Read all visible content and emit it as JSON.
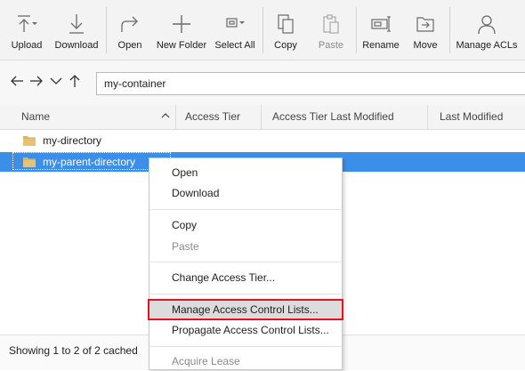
{
  "toolbar": {
    "buttons": [
      {
        "label": "Upload",
        "icon": "upload-icon"
      },
      {
        "label": "Download",
        "icon": "download-icon"
      },
      {
        "label": "Open",
        "icon": "open-arrow-icon"
      },
      {
        "label": "New Folder",
        "icon": "plus-icon"
      },
      {
        "label": "Select All",
        "icon": "select-all-icon"
      },
      {
        "label": "Copy",
        "icon": "copy-icon"
      },
      {
        "label": "Paste",
        "icon": "paste-icon",
        "disabled": true
      },
      {
        "label": "Rename",
        "icon": "rename-icon"
      },
      {
        "label": "Move",
        "icon": "move-icon"
      },
      {
        "label": "Manage ACLs",
        "icon": "person-icon"
      }
    ]
  },
  "address": {
    "path": "my-container"
  },
  "columns": [
    "Name",
    "Access Tier",
    "Access Tier Last Modified",
    "Last Modified"
  ],
  "rows": [
    {
      "name": "my-directory"
    },
    {
      "name": "my-parent-directory",
      "selected": true
    }
  ],
  "status": {
    "text": "Showing 1 to 2 of 2 cached"
  },
  "context_menu": {
    "items": [
      {
        "label": "Open"
      },
      {
        "label": "Download"
      },
      {
        "label": "Copy"
      },
      {
        "label": "Paste",
        "disabled": true
      },
      {
        "label": "Change Access Tier..."
      },
      {
        "label": "Manage Access Control Lists...",
        "highlighted": true
      },
      {
        "label": "Propagate Access Control Lists..."
      },
      {
        "label": "Acquire Lease",
        "disabled": true
      }
    ]
  },
  "colors": {
    "selection": "#3c8fe8",
    "highlight_outline": "#e81123",
    "folder": "#dcb35c"
  }
}
